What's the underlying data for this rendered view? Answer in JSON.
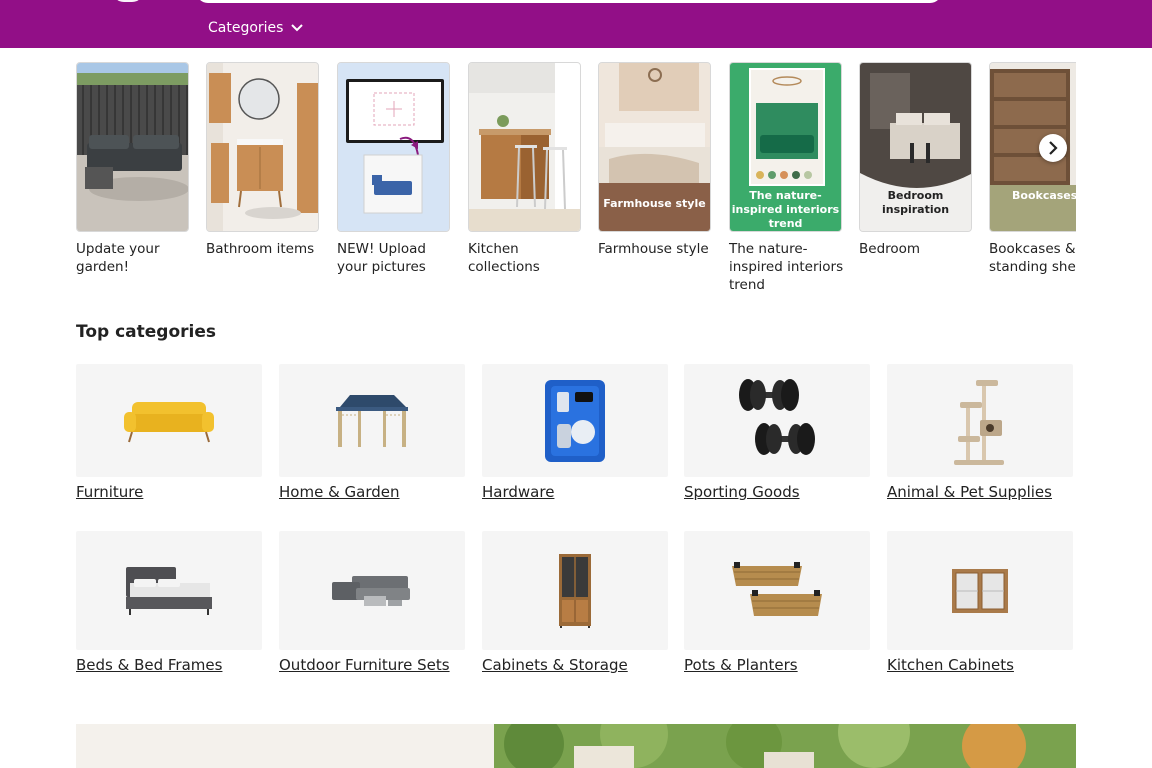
{
  "header": {
    "categories_label": "Categories",
    "brand_color": "#920f87"
  },
  "inspiration": {
    "cards": [
      {
        "caption": "Update your garden!"
      },
      {
        "caption": "Bathroom items"
      },
      {
        "caption": "NEW! Upload your pictures"
      },
      {
        "caption": "Kitchen collections"
      },
      {
        "caption": "Farmhouse style",
        "overlay": "Farmhouse style"
      },
      {
        "caption": "The nature-inspired interiors trend",
        "overlay": "The nature-inspired interiors trend"
      },
      {
        "caption": "Bedroom",
        "overlay": "Bedroom inspiration"
      },
      {
        "caption": "Bookcases & standing shelves",
        "overlay": "Bookcases & standing shelves"
      }
    ]
  },
  "top_categories": {
    "title": "Top categories",
    "items": [
      {
        "label": "Furniture",
        "icon": "sofa-icon"
      },
      {
        "label": "Home & Garden",
        "icon": "gazebo-icon"
      },
      {
        "label": "Hardware",
        "icon": "spray-gun-kit-icon"
      },
      {
        "label": "Sporting Goods",
        "icon": "dumbbells-icon"
      },
      {
        "label": "Animal & Pet Supplies",
        "icon": "cat-tree-icon"
      },
      {
        "label": "Beds & Bed Frames",
        "icon": "bed-icon"
      },
      {
        "label": "Outdoor Furniture Sets",
        "icon": "outdoor-sofa-set-icon"
      },
      {
        "label": "Cabinets & Storage",
        "icon": "tall-cabinet-icon"
      },
      {
        "label": "Pots & Planters",
        "icon": "planter-boxes-icon"
      },
      {
        "label": "Kitchen Cabinets",
        "icon": "wall-cabinet-icon"
      }
    ]
  }
}
